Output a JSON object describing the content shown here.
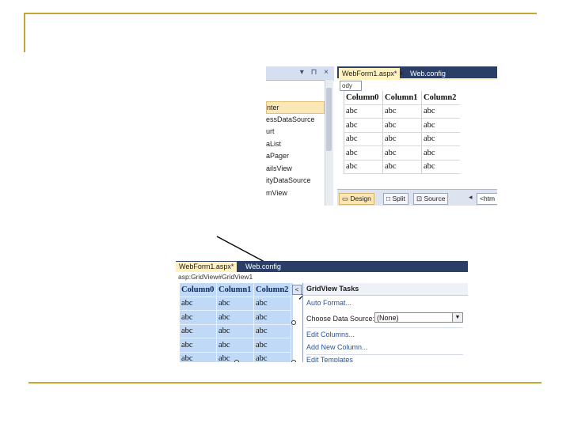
{
  "top_screenshot": {
    "toolbox": {
      "items": [
        "nter",
        "essDataSource",
        "urt",
        "aList",
        "aPager",
        "ailsView",
        "ityDataSource",
        "mView"
      ],
      "selected_index": 0,
      "header_icons": "▾ ⊓ ×"
    },
    "editor": {
      "active_tab": "WebForm1.aspx*",
      "active_tab_close": "×",
      "other_tab": "Web.config",
      "breadcrumb": "ody",
      "grid": {
        "headers": [
          "Column0",
          "Column1",
          "Column2"
        ],
        "rows": [
          [
            "abc",
            "abc",
            "abc"
          ],
          [
            "abc",
            "abc",
            "abc"
          ],
          [
            "abc",
            "abc",
            "abc"
          ],
          [
            "abc",
            "abc",
            "abc"
          ],
          [
            "abc",
            "abc",
            "abc"
          ]
        ]
      },
      "status_bar": {
        "design": "Design",
        "split": "Split",
        "source": "Source",
        "nav_arrow": "◂",
        "tag": "<htm"
      }
    }
  },
  "bottom_screenshot": {
    "active_tab": "WebForm1.aspx*",
    "other_tab": "Web.config",
    "breadcrumb": "asp:GridView#GridView1",
    "grid": {
      "headers": [
        "Column0",
        "Column1",
        "Column2"
      ],
      "rows": [
        [
          "abc",
          "abc",
          "abc"
        ],
        [
          "abc",
          "abc",
          "abc"
        ],
        [
          "abc",
          "abc",
          "abc"
        ],
        [
          "abc",
          "abc",
          "abc"
        ],
        [
          "abc",
          "abc",
          "abc"
        ]
      ]
    },
    "smart_tag": "<",
    "tasks_panel": {
      "title": "GridView Tasks",
      "auto_format": "Auto Format...",
      "choose_data_source_label": "Choose Data Source:",
      "data_source_value": "(None)",
      "edit_columns": "Edit Columns...",
      "add_new_column": "Add New Column...",
      "edit_templates": "Edit Templates"
    }
  },
  "colors": {
    "accent_rule": "#c8a62e",
    "tab_bar": "#2b3f66",
    "active_tab": "#fff1c0",
    "selected_grid": "#bfd9f7"
  }
}
